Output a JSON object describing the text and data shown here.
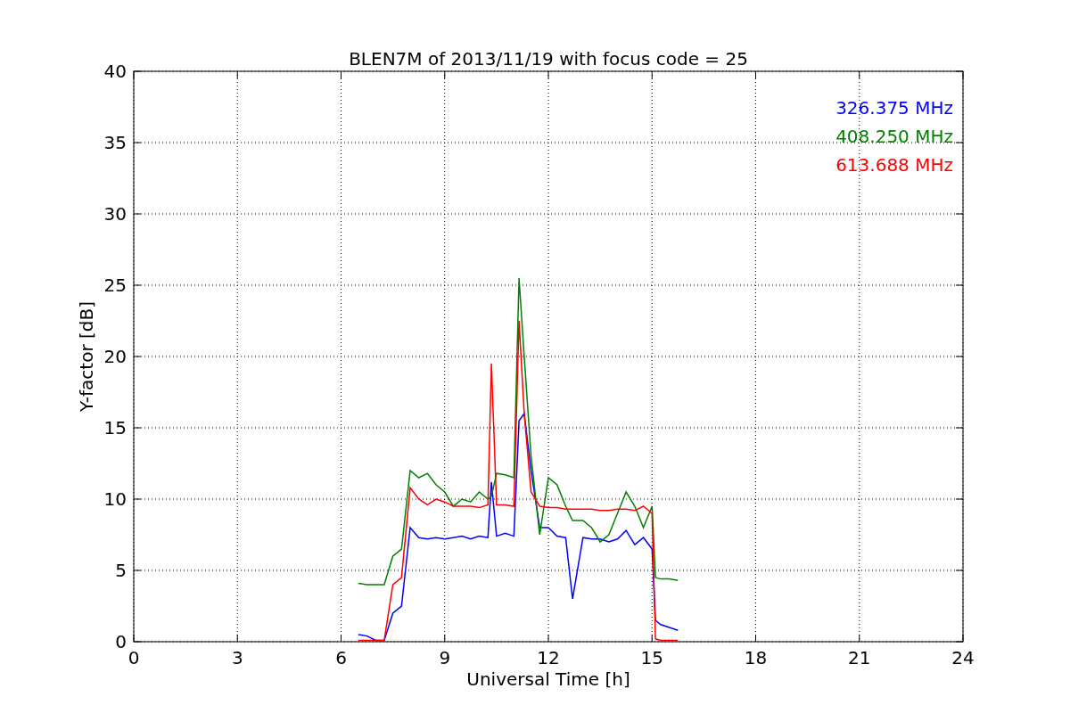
{
  "figure": {
    "chart_data": {
      "type": "line",
      "title": "BLEN7M of 2013/11/19 with focus code = 25",
      "xlabel": "Universal Time [h]",
      "ylabel": "Y-factor [dB]",
      "xlim": [
        0,
        24
      ],
      "ylim": [
        0,
        40
      ],
      "xticks": [
        0,
        3,
        6,
        9,
        12,
        15,
        18,
        21,
        24
      ],
      "yticks": [
        0,
        5,
        10,
        15,
        20,
        25,
        30,
        35,
        40
      ],
      "grid": true,
      "x": [
        6.5,
        6.75,
        7,
        7.25,
        7.5,
        7.75,
        8,
        8.25,
        8.5,
        8.75,
        9,
        9.25,
        9.5,
        9.75,
        10,
        10.25,
        10.35,
        10.5,
        10.75,
        11,
        11.15,
        11.3,
        11.5,
        11.75,
        12,
        12.25,
        12.5,
        12.7,
        13,
        13.25,
        13.5,
        13.75,
        14,
        14.25,
        14.5,
        14.75,
        15,
        15.1,
        15.25,
        15.5,
        15.75
      ],
      "series": [
        {
          "name": "326.375 MHz",
          "color": "#0000ff",
          "values": [
            0.5,
            0.4,
            0.1,
            0.1,
            2,
            2.5,
            8,
            7.3,
            7.2,
            7.3,
            7.2,
            7.3,
            7.4,
            7.2,
            7.4,
            7.3,
            11.2,
            7.4,
            7.6,
            7.4,
            15.5,
            16,
            12,
            8,
            8,
            7.4,
            7.3,
            3,
            7.3,
            7.2,
            7.2,
            7,
            7.2,
            7.8,
            6.8,
            7.3,
            6.5,
            1.5,
            1.2,
            1,
            0.8
          ]
        },
        {
          "name": "408.250 MHz",
          "color": "#008000",
          "values": [
            4.1,
            4,
            4,
            4,
            6,
            6.5,
            12,
            11.5,
            11.8,
            11,
            10.5,
            9.5,
            10,
            9.8,
            10.5,
            10,
            10.2,
            11.8,
            11.7,
            11.5,
            25.5,
            20,
            13,
            7.5,
            11.5,
            11,
            9.5,
            8.5,
            8.5,
            8,
            7,
            7.5,
            9,
            10.5,
            9.5,
            8,
            9.5,
            4.5,
            4.4,
            4.4,
            4.3
          ]
        },
        {
          "name": "613.688 MHz",
          "color": "#ff0000",
          "values": [
            0.1,
            0.1,
            0.1,
            0.1,
            4,
            4.5,
            10.8,
            10,
            9.6,
            10,
            9.8,
            9.5,
            9.5,
            9.5,
            9.4,
            9.6,
            19.5,
            9.6,
            9.6,
            9.5,
            22.5,
            16,
            10.5,
            9.5,
            9.4,
            9.4,
            9.3,
            9.3,
            9.3,
            9.3,
            9.2,
            9.2,
            9.3,
            9.3,
            9.2,
            9.5,
            9,
            0.2,
            0.1,
            0.1,
            0.1
          ]
        }
      ]
    }
  }
}
